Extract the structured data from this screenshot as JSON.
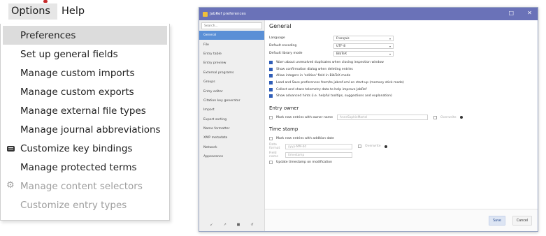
{
  "menubar": {
    "options_label": "Options",
    "help_label": "Help"
  },
  "menu": {
    "items": [
      {
        "label": "Preferences"
      },
      {
        "label": "Set up general fields"
      },
      {
        "label": "Manage custom imports"
      },
      {
        "label": "Manage custom exports"
      },
      {
        "label": "Manage external file types"
      },
      {
        "label": "Manage journal abbreviations"
      },
      {
        "label": "Customize key bindings",
        "icon": "keyboard-icon"
      },
      {
        "label": "Manage protected terms"
      },
      {
        "label": "Manage content selectors",
        "icon": "gear-icon"
      },
      {
        "label": "Customize entry types"
      }
    ]
  },
  "window": {
    "title": "JabRef preferences",
    "minimize_glyph": "□",
    "close_glyph": "✕",
    "search_placeholder": "Search...",
    "nav": [
      "General",
      "File",
      "Entry table",
      "Entry preview",
      "External programs",
      "Groups",
      "Entry editor",
      "Citation key generator",
      "Import",
      "Export sorting",
      "Name formatter",
      "XMP metadata",
      "Network",
      "Appearance"
    ],
    "nav_icons": [
      "↙",
      "↗",
      "■",
      "↺"
    ],
    "general": {
      "heading": "General",
      "language_label": "Language",
      "language_value": "Français",
      "encoding_label": "Default encoding",
      "encoding_value": "UTF-8",
      "mode_label": "Default library mode",
      "mode_value": "BibTeX",
      "checks": [
        "Warn about unresolved duplicates when closing inspection window",
        "Show confirmation dialog when deleting entries",
        "Allow integers in 'edition' field in BibTeX mode",
        "Load and Save preferences from/to jabref.xml on start-up (memory stick mode)",
        "Collect and share telemetry data to help improve JabRef",
        "Show advanced hints (i.e. helpful tooltips, suggestions and explanation)"
      ]
    },
    "entry_owner": {
      "heading": "Entry owner",
      "check_label": "Mark new entries with owner name",
      "owner_value": "AnneSophieMartel",
      "overwrite_label": "Overwrite"
    },
    "time_stamp": {
      "heading": "Time stamp",
      "check_label": "Mark new entries with addition date",
      "date_format_label": "Date format",
      "date_format_value": "yyyy-MM-dd",
      "overwrite_label": "Overwrite",
      "field_name_label": "Field name",
      "field_name_value": "timestamp",
      "update_label": "Update timestamp on modification"
    },
    "buttons": {
      "save": "Save",
      "cancel": "Cancel"
    }
  },
  "colors": {
    "titlebar": "#6a72b8",
    "selected_nav": "#5a8fd6",
    "checkbox_on": "#2f5db7"
  }
}
